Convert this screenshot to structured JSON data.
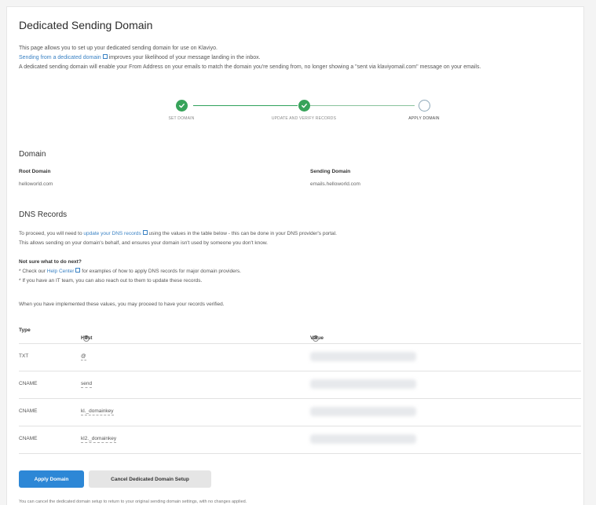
{
  "page": {
    "title": "Dedicated Sending Domain",
    "intro_line1": "This page allows you to set up your dedicated sending domain for use on Klaviyo.",
    "intro_line2_link": "Sending from a dedicated domain",
    "intro_line2_rest": " improves your likelihood of your message landing in the inbox.",
    "intro_line3": "A dedicated sending domain will enable your From Address on your emails to match the domain you're sending from, no longer showing a \"sent via klaviyomail.com\" message on your emails."
  },
  "stepper": {
    "steps": [
      {
        "label": "SET DOMAIN",
        "status": "complete"
      },
      {
        "label": "UPDATE AND VERIFY RECORDS",
        "status": "complete"
      },
      {
        "label": "APPLY DOMAIN",
        "status": "current"
      }
    ]
  },
  "domain": {
    "heading": "Domain",
    "root_label": "Root Domain",
    "root_value": "helloworld.com",
    "sending_label": "Sending Domain",
    "sending_value": "emails.helloworld.com"
  },
  "dns": {
    "heading": "DNS Records",
    "p1_pre": "To proceed, you will need to ",
    "p1_link": "update your DNS records",
    "p1_post": " using the values in the table below - this can be done in your DNS provider's portal.",
    "p2": "This allows sending on your domain's behalf, and ensures your domain isn't used by someone you don't know.",
    "not_sure": "Not sure what to do next?",
    "bullet1_pre": "* Check our ",
    "bullet1_link": "Help Center",
    "bullet1_post": " for examples of how to apply DNS records for major domain providers.",
    "bullet2": "* If you have an IT team, you can also reach out to them to update these records.",
    "p3": "When you have implemented these values, you may proceed to have your records verified."
  },
  "table": {
    "col_type": "Type",
    "col_host": "Host",
    "col_value": "Value",
    "rows": [
      {
        "type": "TXT",
        "host": "@"
      },
      {
        "type": "CNAME",
        "host": "send"
      },
      {
        "type": "CNAME",
        "host": "kl._domainkey"
      },
      {
        "type": "CNAME",
        "host": "kl2._domainkey"
      }
    ]
  },
  "actions": {
    "apply_label": "Apply Domain",
    "cancel_label": "Cancel Dedicated Domain Setup",
    "footnote": "You can cancel the dedicated domain setup to return to your original sending domain settings, with no changes applied."
  },
  "colors": {
    "primary": "#2d87d6",
    "success": "#37a35a",
    "link": "#3a82c4"
  }
}
